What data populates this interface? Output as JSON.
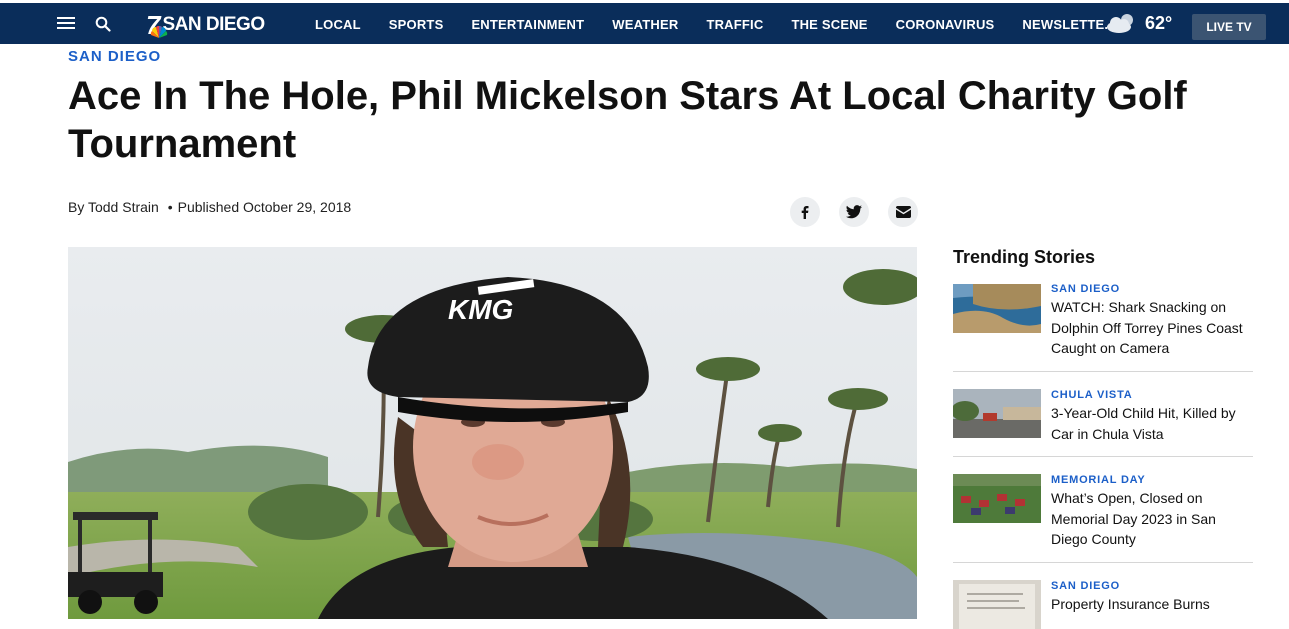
{
  "nav": {
    "logo_number": "7",
    "logo_text": "SAN DIEGO",
    "links": [
      "LOCAL",
      "SPORTS",
      "ENTERTAINMENT",
      "WEATHER",
      "TRAFFIC",
      "THE SCENE",
      "CORONAVIRUS",
      "NEWSLETTE..."
    ],
    "temperature": "62°",
    "live_tv": "LIVE TV",
    "weather_icon": "partly-cloudy-icon"
  },
  "article": {
    "section": "SAN DIEGO",
    "headline": "Ace In The Hole, Phil Mickelson Stars At Local Charity Golf Tournament",
    "byline_prefix": "By",
    "author": "Todd Strain",
    "bullet": "•",
    "published": "Published October 29, 2018",
    "hat_logo_text": "KMG"
  },
  "share": [
    "facebook-icon",
    "twitter-icon",
    "email-icon"
  ],
  "trending": {
    "title": "Trending Stories",
    "stories": [
      {
        "category": "SAN DIEGO",
        "title": "WATCH: Shark Snacking on Dolphin Off Torrey Pines Coast Caught on Camera"
      },
      {
        "category": "CHULA VISTA",
        "title": "3-Year-Old Child Hit, Killed by Car in Chula Vista"
      },
      {
        "category": "MEMORIAL DAY",
        "title": "What’s Open, Closed on Memorial Day 2023 in San Diego County"
      },
      {
        "category": "SAN DIEGO",
        "title": "Property Insurance Burns"
      }
    ]
  },
  "colors": {
    "nav_bg": "#0a2d5a",
    "accent": "#1c5fc8",
    "live_tv_bg": "#3b5472"
  }
}
